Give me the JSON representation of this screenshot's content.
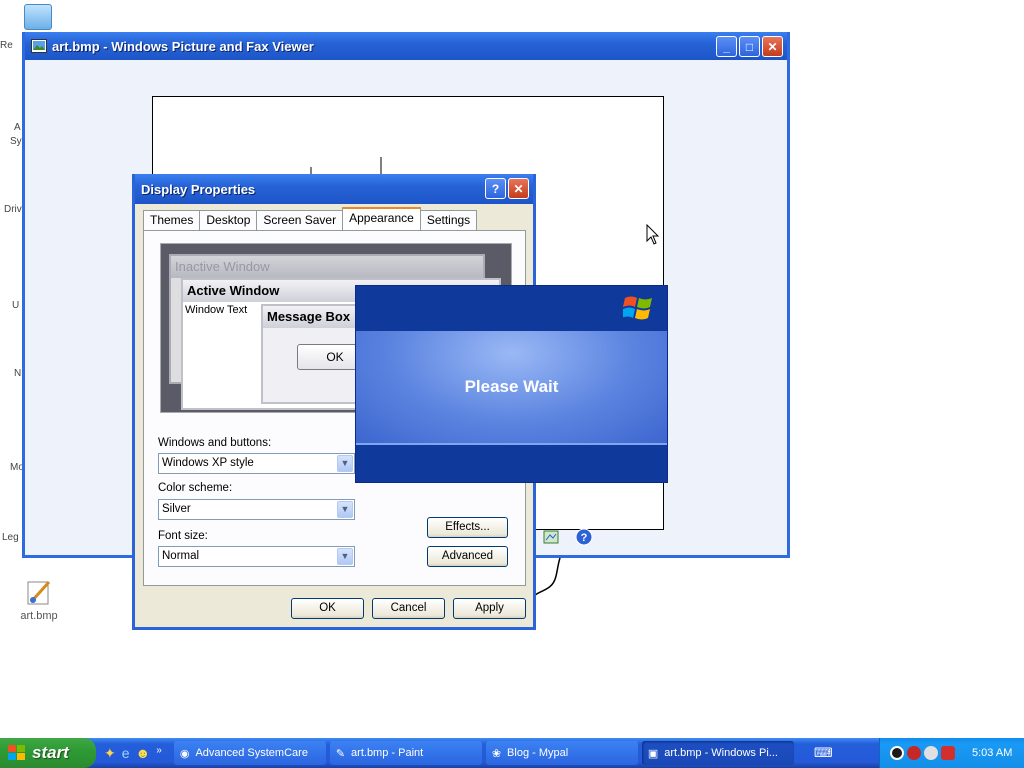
{
  "desktop": {
    "recycle_bin_label": "Re",
    "cut_labels": [
      "A",
      "Sy",
      "Driv",
      "U",
      "N",
      "Mo",
      "Leg"
    ],
    "art_icon_label": "art.bmp"
  },
  "viewer": {
    "title": "art.bmp - Windows Picture and Fax Viewer"
  },
  "dialog": {
    "title": "Display Properties",
    "tabs": [
      "Themes",
      "Desktop",
      "Screen Saver",
      "Appearance",
      "Settings"
    ],
    "preview": {
      "inactive_title": "Inactive Window",
      "active_title": "Active Window",
      "window_text": "Window Text",
      "message_box_title": "Message Box",
      "ok_label": "OK"
    },
    "windows_buttons_label": "Windows and buttons:",
    "windows_buttons_value": "Windows XP style",
    "color_scheme_label": "Color scheme:",
    "color_scheme_value": "Silver",
    "font_size_label": "Font size:",
    "font_size_value": "Normal",
    "effects_label": "Effects...",
    "advanced_label": "Advanced",
    "ok_label": "OK",
    "cancel_label": "Cancel",
    "apply_label": "Apply"
  },
  "splash": {
    "message": "Please Wait"
  },
  "taskbar": {
    "start_label": "start",
    "tasks": [
      {
        "label": "Advanced SystemCare",
        "icon": "systemcare-icon"
      },
      {
        "label": "art.bmp - Paint",
        "icon": "paint-icon"
      },
      {
        "label": "Blog - Mypal",
        "icon": "browser-icon"
      },
      {
        "label": "art.bmp - Windows Pi...",
        "icon": "picture-viewer-icon"
      }
    ],
    "clock": "5:03 AM"
  },
  "colors": {
    "xp_blue": "#2459d8",
    "start_green": "#2f9b35",
    "tray_blue": "#138ee9"
  }
}
